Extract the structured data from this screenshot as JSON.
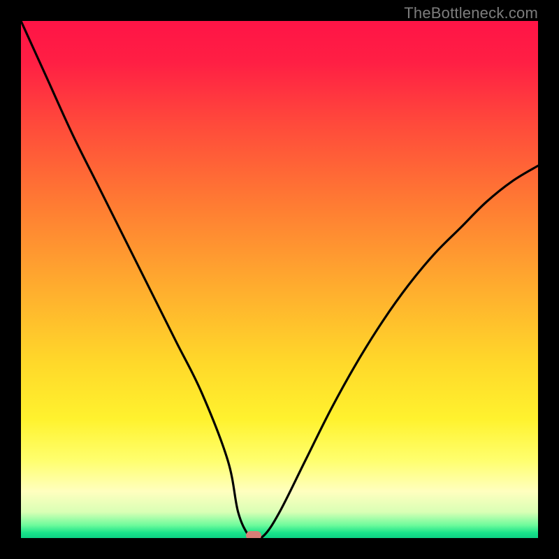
{
  "watermark": "TheBottleneck.com",
  "chart_data": {
    "type": "line",
    "title": "",
    "xlabel": "",
    "ylabel": "",
    "xlim": [
      0,
      100
    ],
    "ylim": [
      0,
      100
    ],
    "grid": false,
    "legend": false,
    "series": [
      {
        "name": "bottleneck-curve",
        "x": [
          0,
          5,
          10,
          15,
          20,
          25,
          30,
          35,
          40,
          42,
          44,
          45,
          47,
          50,
          55,
          60,
          65,
          70,
          75,
          80,
          85,
          90,
          95,
          100
        ],
        "y": [
          100,
          89,
          78,
          68,
          58,
          48,
          38,
          28,
          15,
          5,
          0.5,
          0,
          0.5,
          5,
          15,
          25,
          34,
          42,
          49,
          55,
          60,
          65,
          69,
          72
        ]
      }
    ],
    "marker": {
      "x": 45,
      "y": 0,
      "color": "#d77e78"
    },
    "background_gradient": {
      "top": "#ff1446",
      "mid": "#ffd82a",
      "bottom": "#0ed184"
    }
  }
}
